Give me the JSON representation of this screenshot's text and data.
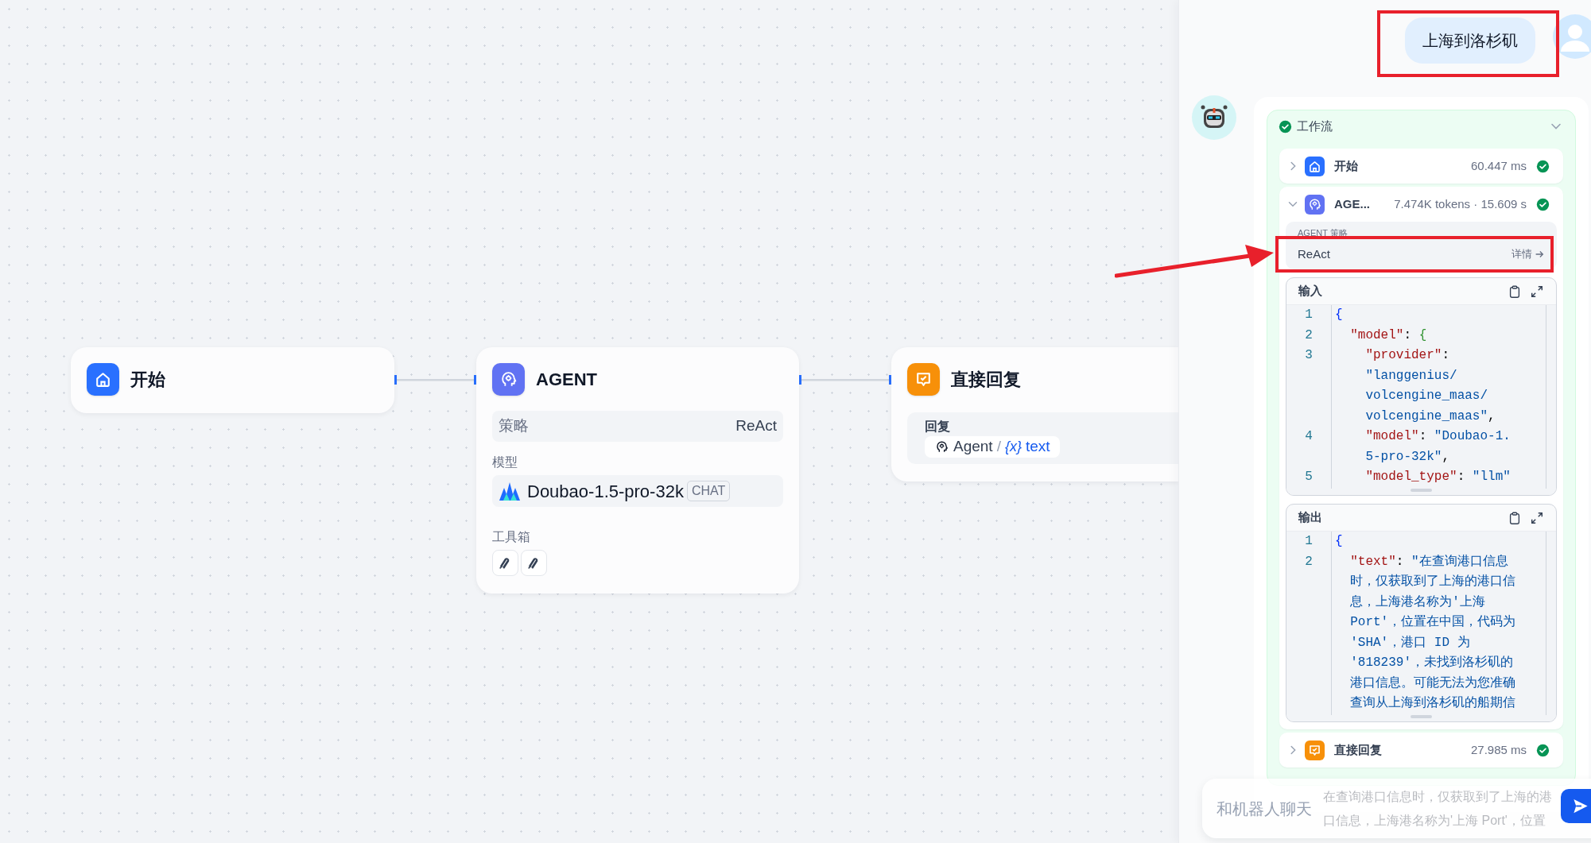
{
  "canvas": {
    "nodes": [
      {
        "kind": "start",
        "title": "开始"
      },
      {
        "kind": "agent",
        "title": "AGENT",
        "strategy_label": "策略",
        "strategy": "ReAct",
        "model_label": "模型",
        "model": "Doubao-1.5-pro-32k",
        "model_tag": "CHAT",
        "tools_label": "工具箱",
        "tools": [
          {
            "kind": "tool"
          },
          {
            "kind": "tool"
          }
        ]
      },
      {
        "kind": "answer",
        "title": "直接回复",
        "reply_label": "回复",
        "variable": {
          "node": "Agent",
          "separator": "/",
          "var_icon": "{x}",
          "name": "text"
        }
      }
    ]
  },
  "chat": {
    "user_message": "上海到洛杉矶",
    "workflow": {
      "title": "工作流",
      "success": true,
      "expanded": true,
      "steps": [
        {
          "kind": "start",
          "title": "开始",
          "meta": "60.447 ms",
          "success": true,
          "expanded": false
        },
        {
          "kind": "agent",
          "title": "AGE...",
          "meta": "7.474K tokens · 15.609 s",
          "success": true,
          "expanded": true,
          "strategy_label": "AGENT 策略",
          "strategy": "ReAct",
          "detail_link": "详情",
          "input": {
            "title": "输入",
            "lines": [
              {
                "no": "1",
                "rows": [
                  {
                    "tokens": [
                      {
                        "kind": "brace",
                        "text": "{"
                      }
                    ]
                  }
                ]
              },
              {
                "no": "2",
                "rows": [
                  {
                    "tokens": [
                      {
                        "kind": "key",
                        "text": "  \"model\""
                      },
                      {
                        "kind": "punct",
                        "text": ": "
                      },
                      {
                        "kind": "brace2",
                        "text": "{"
                      }
                    ]
                  }
                ]
              },
              {
                "no": "3",
                "rows": [
                  {
                    "tokens": [
                      {
                        "kind": "key",
                        "text": "    \"provider\""
                      },
                      {
                        "kind": "punct",
                        "text": ":"
                      }
                    ]
                  },
                  {
                    "tokens": [
                      {
                        "kind": "string",
                        "text": "    \"langgenius/"
                      }
                    ]
                  },
                  {
                    "tokens": [
                      {
                        "kind": "string",
                        "text": "    volcengine_maas/"
                      }
                    ]
                  },
                  {
                    "tokens": [
                      {
                        "kind": "string",
                        "text": "    volcengine_maas\""
                      },
                      {
                        "kind": "punct",
                        "text": ","
                      }
                    ]
                  }
                ]
              },
              {
                "no": "4",
                "rows": [
                  {
                    "tokens": [
                      {
                        "kind": "key",
                        "text": "    \"model\""
                      },
                      {
                        "kind": "punct",
                        "text": ": "
                      },
                      {
                        "kind": "string",
                        "text": "\"Doubao-1."
                      }
                    ]
                  },
                  {
                    "tokens": [
                      {
                        "kind": "string",
                        "text": "    5-pro-32k\""
                      },
                      {
                        "kind": "punct",
                        "text": ","
                      }
                    ]
                  }
                ]
              },
              {
                "no": "5",
                "rows": [
                  {
                    "tokens": [
                      {
                        "kind": "key",
                        "text": "    \"model_type\""
                      },
                      {
                        "kind": "punct",
                        "text": ": "
                      },
                      {
                        "kind": "string",
                        "text": "\"llm\""
                      }
                    ]
                  }
                ]
              }
            ]
          },
          "output": {
            "title": "输出",
            "lines": [
              {
                "no": "1",
                "rows": [
                  {
                    "tokens": [
                      {
                        "kind": "brace",
                        "text": "{"
                      }
                    ]
                  }
                ]
              },
              {
                "no": "2",
                "rows": [
                  {
                    "tokens": [
                      {
                        "kind": "key",
                        "text": "  \"text\""
                      },
                      {
                        "kind": "punct",
                        "text": ": "
                      },
                      {
                        "kind": "string",
                        "text": "\"在查询港口信息"
                      }
                    ]
                  },
                  {
                    "tokens": [
                      {
                        "kind": "string",
                        "text": "  时，仅获取到了上海的港口信"
                      }
                    ]
                  },
                  {
                    "tokens": [
                      {
                        "kind": "string",
                        "text": "  息，上海港名称为'上海"
                      }
                    ]
                  },
                  {
                    "tokens": [
                      {
                        "kind": "string",
                        "text": "  Port'，位置在中国，代码为"
                      }
                    ]
                  },
                  {
                    "tokens": [
                      {
                        "kind": "string",
                        "text": "  'SHA'，港口 ID 为"
                      }
                    ]
                  },
                  {
                    "tokens": [
                      {
                        "kind": "string",
                        "text": "  '818239'，未找到洛杉矶的"
                      }
                    ]
                  },
                  {
                    "tokens": [
                      {
                        "kind": "string",
                        "text": "  港口信息。可能无法为您准确"
                      }
                    ]
                  },
                  {
                    "tokens": [
                      {
                        "kind": "string",
                        "text": "  查询从上海到洛杉矶的船期信"
                      }
                    ]
                  }
                ]
              }
            ]
          }
        },
        {
          "kind": "answer",
          "title": "直接回复",
          "meta": "27.985 ms",
          "success": true,
          "expanded": false
        }
      ]
    },
    "answer_preview": [
      "在查询港口信息时，仅获取到了上海的港",
      "口信息，上海港名称为'上海 Port'，位置"
    ],
    "composer": {
      "placeholder": "和机器人聊天"
    }
  }
}
